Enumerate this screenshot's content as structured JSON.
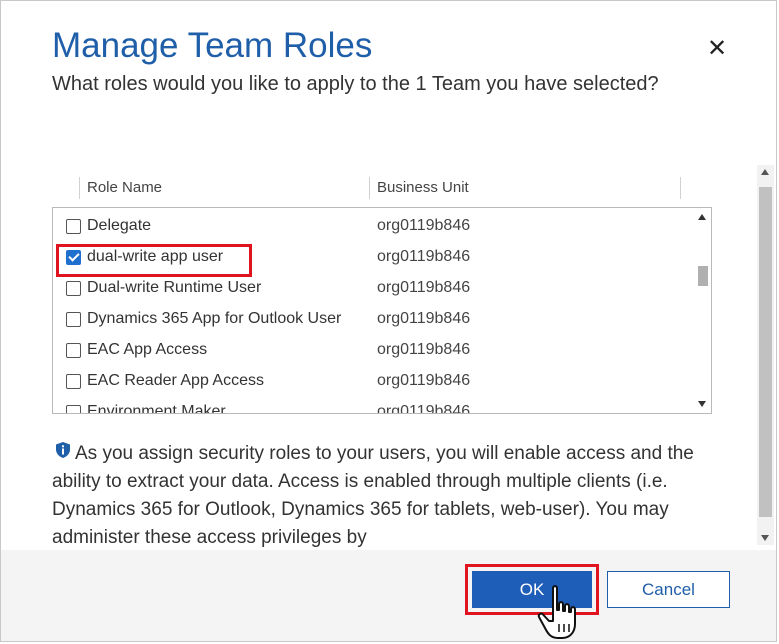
{
  "dialog": {
    "title": "Manage Team Roles",
    "subtitle": "What roles would you like to apply to the 1 Team you have selected?",
    "close_icon": "close-icon"
  },
  "grid": {
    "columns": [
      "Role Name",
      "Business Unit"
    ],
    "rows": [
      {
        "role": "Delegate",
        "business_unit": "org0119b846",
        "checked": false
      },
      {
        "role": "dual-write app user",
        "business_unit": "org0119b846",
        "checked": true
      },
      {
        "role": "Dual-write Runtime User",
        "business_unit": "org0119b846",
        "checked": false
      },
      {
        "role": "Dynamics 365 App for Outlook User",
        "business_unit": "org0119b846",
        "checked": false
      },
      {
        "role": "EAC App Access",
        "business_unit": "org0119b846",
        "checked": false
      },
      {
        "role": "EAC Reader App Access",
        "business_unit": "org0119b846",
        "checked": false
      },
      {
        "role": "Environment Maker",
        "business_unit": "org0119b846",
        "checked": false
      }
    ]
  },
  "info": {
    "icon": "shield-info-icon",
    "text": "As you assign security roles to your users, you will enable access and the ability to extract your data. Access is enabled through multiple clients (i.e. Dynamics 365 for Outlook, Dynamics 365 for tablets, web-user). You may administer these access privileges by"
  },
  "footer": {
    "ok_label": "OK",
    "cancel_label": "Cancel"
  },
  "colors": {
    "accent": "#1f5eb8",
    "highlight": "#e0141e"
  }
}
